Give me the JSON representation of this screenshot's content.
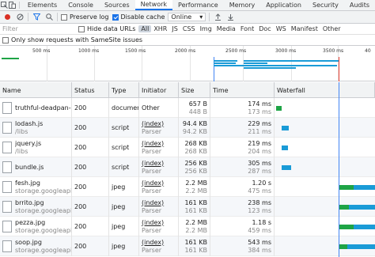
{
  "tabs": [
    "Elements",
    "Console",
    "Sources",
    "Network",
    "Performance",
    "Memory",
    "Application",
    "Security",
    "Audits"
  ],
  "toolbar": {
    "preserve_log": "Preserve log",
    "disable_cache": "Disable cache",
    "throttle": "Online"
  },
  "filter": {
    "placeholder": "Filter",
    "hide_data_urls": "Hide data URLs",
    "types": [
      "All",
      "XHR",
      "JS",
      "CSS",
      "Img",
      "Media",
      "Font",
      "Doc",
      "WS",
      "Manifest",
      "Other"
    ],
    "samesite": "Only show requests with SameSite issues"
  },
  "overview": {
    "ticks": [
      "500 ms",
      "1000 ms",
      "1500 ms",
      "2000 ms",
      "2500 ms",
      "3000 ms",
      "3500 ms",
      "40"
    ]
  },
  "columns": [
    "Name",
    "Status",
    "Type",
    "Initiator",
    "Size",
    "Time",
    "Waterfall"
  ],
  "rows": [
    {
      "name": "truthful-deadpan-...",
      "path": "",
      "status": "200",
      "type": "document",
      "initiator": "Other",
      "initiator_sub": "",
      "size": "657 B",
      "size_sub": "448 B",
      "time": "174 ms",
      "time_sub": "173 ms",
      "icon": "html-file-icon",
      "color": "#1ea446"
    },
    {
      "name": "lodash.js",
      "path": "/libs",
      "status": "200",
      "type": "script",
      "initiator": "(index)",
      "initiator_sub": "Parser",
      "size": "94.4 KB",
      "size_sub": "94.2 KB",
      "time": "229 ms",
      "time_sub": "211 ms",
      "icon": "js-file-icon",
      "color": "#1a9bd7"
    },
    {
      "name": "jquery.js",
      "path": "/libs",
      "status": "200",
      "type": "script",
      "initiator": "(index)",
      "initiator_sub": "Parser",
      "size": "268 KB",
      "size_sub": "268 KB",
      "time": "219 ms",
      "time_sub": "204 ms",
      "icon": "js-file-icon",
      "color": "#1a9bd7"
    },
    {
      "name": "bundle.js",
      "path": "",
      "status": "200",
      "type": "script",
      "initiator": "(index)",
      "initiator_sub": "Parser",
      "size": "256 KB",
      "size_sub": "256 KB",
      "time": "305 ms",
      "time_sub": "287 ms",
      "icon": "js-file-icon",
      "color": "#1a9bd7"
    },
    {
      "name": "fesh.jpg",
      "path": "storage.googleapi...",
      "status": "200",
      "type": "jpeg",
      "initiator": "(index)",
      "initiator_sub": "Parser",
      "size": "2.2 MB",
      "size_sub": "2.2 MB",
      "time": "1.20 s",
      "time_sub": "475 ms",
      "icon": "image-file-icon",
      "color": "#1a9bd7"
    },
    {
      "name": "brrito.jpg",
      "path": "storage.googleapi...",
      "status": "200",
      "type": "jpeg",
      "initiator": "(index)",
      "initiator_sub": "Parser",
      "size": "161 KB",
      "size_sub": "161 KB",
      "time": "238 ms",
      "time_sub": "123 ms",
      "icon": "image-file-icon",
      "color": "#1a9bd7"
    },
    {
      "name": "pezza.jpg",
      "path": "storage.googleapi...",
      "status": "200",
      "type": "jpeg",
      "initiator": "(index)",
      "initiator_sub": "Parser",
      "size": "2.2 MB",
      "size_sub": "2.2 MB",
      "time": "1.18 s",
      "time_sub": "459 ms",
      "icon": "image-file-icon",
      "color": "#1a9bd7"
    },
    {
      "name": "soop.jpg",
      "path": "storage.googleapi...",
      "status": "200",
      "type": "jpeg",
      "initiator": "(index)",
      "initiator_sub": "Parser",
      "size": "161 KB",
      "size_sub": "161 KB",
      "time": "543 ms",
      "time_sub": "384 ms",
      "icon": "image-file-icon",
      "color": "#1a9bd7"
    }
  ],
  "colors": {
    "accent": "#1a73e8",
    "waiting": "#1ea446",
    "download": "#1a9bd7",
    "load_line": "#e94235",
    "dcl_line": "#4285f4"
  }
}
